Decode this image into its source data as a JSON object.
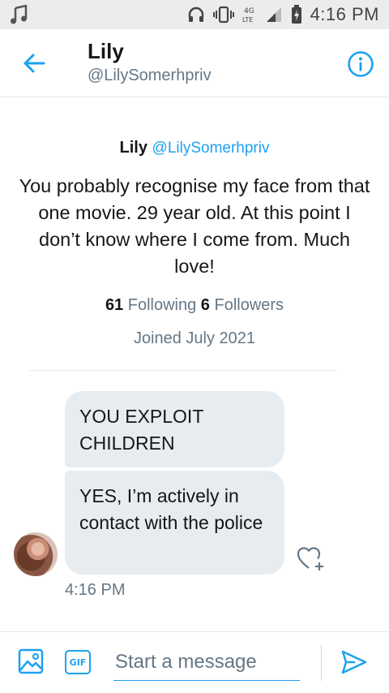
{
  "status_bar": {
    "time": "4:16 PM",
    "network": "4G LTE",
    "icons": [
      "music-note-icon",
      "headphones-icon",
      "vibrate-icon",
      "network-4g-icon",
      "signal-icon",
      "battery-icon"
    ]
  },
  "header": {
    "name": "Lily",
    "handle": "@LilySomerhpriv",
    "back_icon": "arrow-left-icon",
    "info_icon": "info-icon"
  },
  "profile": {
    "name": "Lily",
    "handle": "@LilySomerhpriv",
    "bio": "You probably recognise my face from that one movie. 29 year old. At this point I don’t know where I come from. Much love!",
    "following_count": "61",
    "following_label": "Following",
    "followers_count": "6",
    "followers_label": "Followers",
    "joined": "Joined July 2021"
  },
  "messages": [
    {
      "text": "YOU EXPLOIT CHILDREN"
    },
    {
      "text": "YES, I’m actively in contact with the police"
    }
  ],
  "message_time": "4:16 PM",
  "composer": {
    "placeholder": "Start a message",
    "gif_label": "GIF"
  },
  "colors": {
    "accent": "#1da1f2",
    "bubble": "#e6ecf0",
    "muted": "#657786",
    "status_bar": "#ececec"
  }
}
